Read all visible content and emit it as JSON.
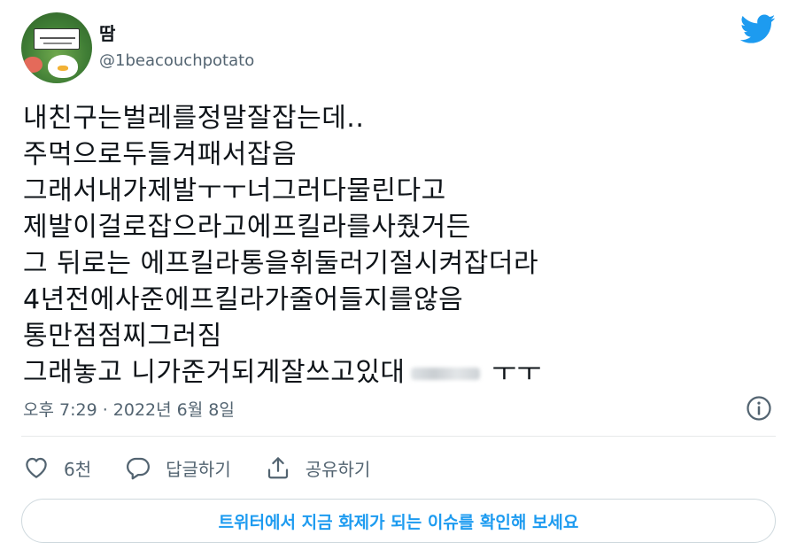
{
  "user": {
    "name": "땀",
    "handle": "@1beacouchpotato"
  },
  "tweet": {
    "lines": [
      "내친구는벌레를정말잘잡는데..",
      "주먹으로두들겨패서잡음",
      "그래서내가제발ㅜㅜ너그러다물린다고",
      "제발이걸로잡으라고에프킬라를사줬거든",
      "그 뒤로는 에프킬라통을휘둘러기절시켜잡더라",
      "4년전에사준에프킬라가줄어들지를않음",
      "통만점점찌그러짐",
      "그래놓고 니가준거되게잘쓰고있대"
    ],
    "last_line_suffix": "ㅜㅜ",
    "timestamp": "오후 7:29 · 2022년 6월 8일"
  },
  "actions": {
    "like_count": "6천",
    "reply_label": "답글하기",
    "share_label": "공유하기"
  },
  "trend_button_label": "트위터에서 지금 화제가 되는 이슈를 확인해 보세요",
  "colors": {
    "accent": "#1d9bf0",
    "secondary_text": "#536471",
    "border": "#cfd9de"
  },
  "icons": [
    "twitter-bird-icon",
    "info-icon",
    "heart-icon",
    "reply-icon",
    "share-icon"
  ]
}
